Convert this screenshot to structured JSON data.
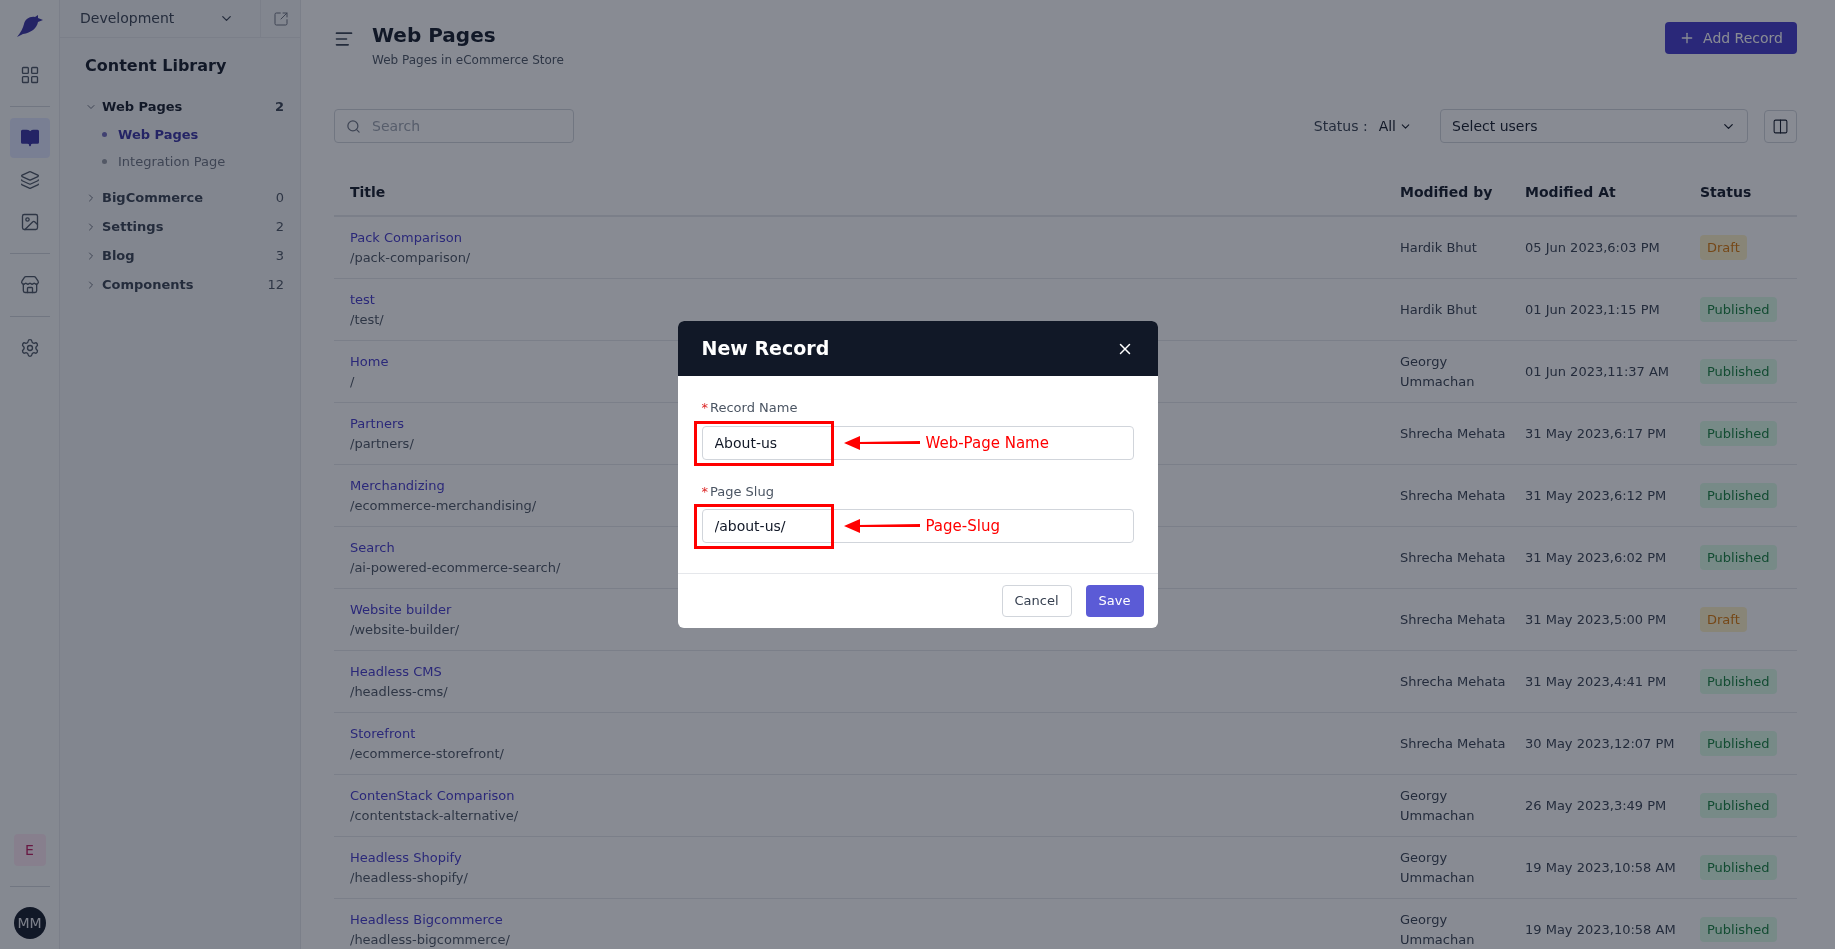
{
  "rail": {
    "items": [
      {
        "kind": "dashboard",
        "selected": false
      },
      {
        "kind": "library",
        "selected": true
      },
      {
        "kind": "layers",
        "selected": false
      },
      {
        "kind": "image",
        "selected": false
      },
      {
        "kind": "store",
        "selected": false
      },
      {
        "kind": "settings",
        "selected": false
      }
    ],
    "workspace_badge": "E",
    "avatar": "MM"
  },
  "sidebar": {
    "environment": "Development",
    "title": "Content Library",
    "items": [
      {
        "label": "Web Pages",
        "count": "2",
        "expanded": true,
        "children": [
          {
            "label": "Web Pages",
            "selected": true
          },
          {
            "label": "Integration Page",
            "selected": false
          }
        ]
      },
      {
        "label": "BigCommerce",
        "count": "0",
        "expanded": false
      },
      {
        "label": "Settings",
        "count": "2",
        "expanded": false
      },
      {
        "label": "Blog",
        "count": "3",
        "expanded": false
      },
      {
        "label": "Components",
        "count": "12",
        "expanded": false
      }
    ]
  },
  "header": {
    "title": "Web Pages",
    "subtitle": "Web Pages in eCommerce Store",
    "add_button": "Add Record"
  },
  "filters": {
    "search_placeholder": "Search",
    "status_label": "Status :",
    "status_value": "All",
    "users_placeholder": "Select users"
  },
  "table": {
    "columns": [
      "Title",
      "Modified by",
      "Modified At",
      "Status"
    ],
    "rows": [
      {
        "title": "Pack Comparison",
        "slug": "/pack-comparison/",
        "modified_by": "Hardik Bhut",
        "modified_at": "05 Jun 2023,6:03 PM",
        "status": {
          "label": "Draft",
          "kind": "draft"
        }
      },
      {
        "title": "test",
        "slug": "/test/",
        "modified_by": "Hardik Bhut",
        "modified_at": "01 Jun 2023,1:15 PM",
        "status": {
          "label": "Published",
          "kind": "published"
        }
      },
      {
        "title": "Home",
        "slug": "/",
        "modified_by": "Georgy Ummachan",
        "modified_at": "01 Jun 2023,11:37 AM",
        "status": {
          "label": "Published",
          "kind": "published"
        }
      },
      {
        "title": "Partners",
        "slug": "/partners/",
        "modified_by": "Shrecha Mehata",
        "modified_at": "31 May 2023,6:17 PM",
        "status": {
          "label": "Published",
          "kind": "published"
        }
      },
      {
        "title": "Merchandizing",
        "slug": "/ecommerce-merchandising/",
        "modified_by": "Shrecha Mehata",
        "modified_at": "31 May 2023,6:12 PM",
        "status": {
          "label": "Published",
          "kind": "published"
        }
      },
      {
        "title": "Search",
        "slug": "/ai-powered-ecommerce-search/",
        "modified_by": "Shrecha Mehata",
        "modified_at": "31 May 2023,6:02 PM",
        "status": {
          "label": "Published",
          "kind": "published"
        }
      },
      {
        "title": "Website builder",
        "slug": "/website-builder/",
        "modified_by": "Shrecha Mehata",
        "modified_at": "31 May 2023,5:00 PM",
        "status": {
          "label": "Draft",
          "kind": "draft"
        }
      },
      {
        "title": "Headless CMS",
        "slug": "/headless-cms/",
        "modified_by": "Shrecha Mehata",
        "modified_at": "31 May 2023,4:41 PM",
        "status": {
          "label": "Published",
          "kind": "published"
        }
      },
      {
        "title": "Storefront",
        "slug": "/ecommerce-storefront/",
        "modified_by": "Shrecha Mehata",
        "modified_at": "30 May 2023,12:07 PM",
        "status": {
          "label": "Published",
          "kind": "published"
        }
      },
      {
        "title": "ContenStack Comparison",
        "slug": "/contentstack-alternative/",
        "modified_by": "Georgy Ummachan",
        "modified_at": "26 May 2023,3:49 PM",
        "status": {
          "label": "Published",
          "kind": "published"
        }
      },
      {
        "title": "Headless Shopify",
        "slug": "/headless-shopify/",
        "modified_by": "Georgy Ummachan",
        "modified_at": "19 May 2023,10:58 AM",
        "status": {
          "label": "Published",
          "kind": "published"
        }
      },
      {
        "title": "Headless Bigcommerce",
        "slug": "/headless-bigcommerce/",
        "modified_by": "Georgy Ummachan",
        "modified_at": "19 May 2023,10:58 AM",
        "status": {
          "label": "Published",
          "kind": "published"
        }
      }
    ]
  },
  "modal": {
    "title": "New Record",
    "fields": [
      {
        "label": "Record Name",
        "required": true,
        "required_mark": "*",
        "value": "About-us",
        "annotation": "Web-Page Name"
      },
      {
        "label": "Page Slug",
        "required": true,
        "required_mark": "*",
        "value": "/about-us/",
        "annotation": "Page-Slug"
      }
    ],
    "cancel_button": "Cancel",
    "save_button": "Save"
  }
}
